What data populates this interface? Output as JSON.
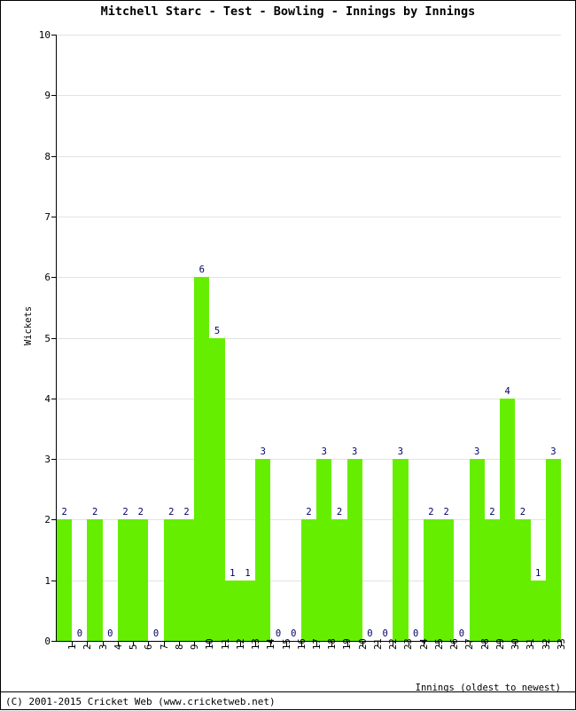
{
  "chart_data": {
    "type": "bar",
    "title": "Mitchell Starc - Test - Bowling - Innings by Innings",
    "xlabel": "Innings (oldest to newest)",
    "ylabel": "Wickets",
    "categories": [
      "1",
      "2",
      "3",
      "4",
      "5",
      "6",
      "7",
      "8",
      "9",
      "10",
      "11",
      "12",
      "13",
      "14",
      "15",
      "16",
      "17",
      "18",
      "19",
      "20",
      "21",
      "22",
      "23",
      "24",
      "25",
      "26",
      "27",
      "28",
      "29",
      "30",
      "31",
      "32",
      "33"
    ],
    "values": [
      2,
      0,
      2,
      0,
      2,
      2,
      0,
      2,
      2,
      6,
      5,
      1,
      1,
      3,
      0,
      0,
      2,
      3,
      2,
      3,
      0,
      0,
      3,
      0,
      2,
      2,
      0,
      3,
      2,
      4,
      2,
      1,
      3
    ],
    "data_labels": [
      "2",
      "0",
      "2",
      "0",
      "2",
      "2",
      "0",
      "2",
      "2",
      "6",
      "5",
      "1",
      "1",
      "3",
      "0",
      "0",
      "2",
      "3",
      "2",
      "3",
      "0",
      "0",
      "3",
      "0",
      "2",
      "2",
      "0",
      "3",
      "2",
      "4",
      "2",
      "1",
      "3"
    ],
    "ylim": [
      0,
      10
    ],
    "yticks": [
      0,
      1,
      2,
      3,
      4,
      5,
      6,
      7,
      8,
      9,
      10
    ],
    "ytick_labels": [
      "0",
      "1",
      "2",
      "3",
      "4",
      "5",
      "6",
      "7",
      "8",
      "9",
      "10"
    ],
    "grid": true,
    "legend": false,
    "bar_color": "#66EE00",
    "label_color": "#000066",
    "grid_color": "#e2e2e2",
    "axis_color": "#000000"
  },
  "footer": {
    "copyright": "(C) 2001-2015 Cricket Web (www.cricketweb.net)"
  }
}
